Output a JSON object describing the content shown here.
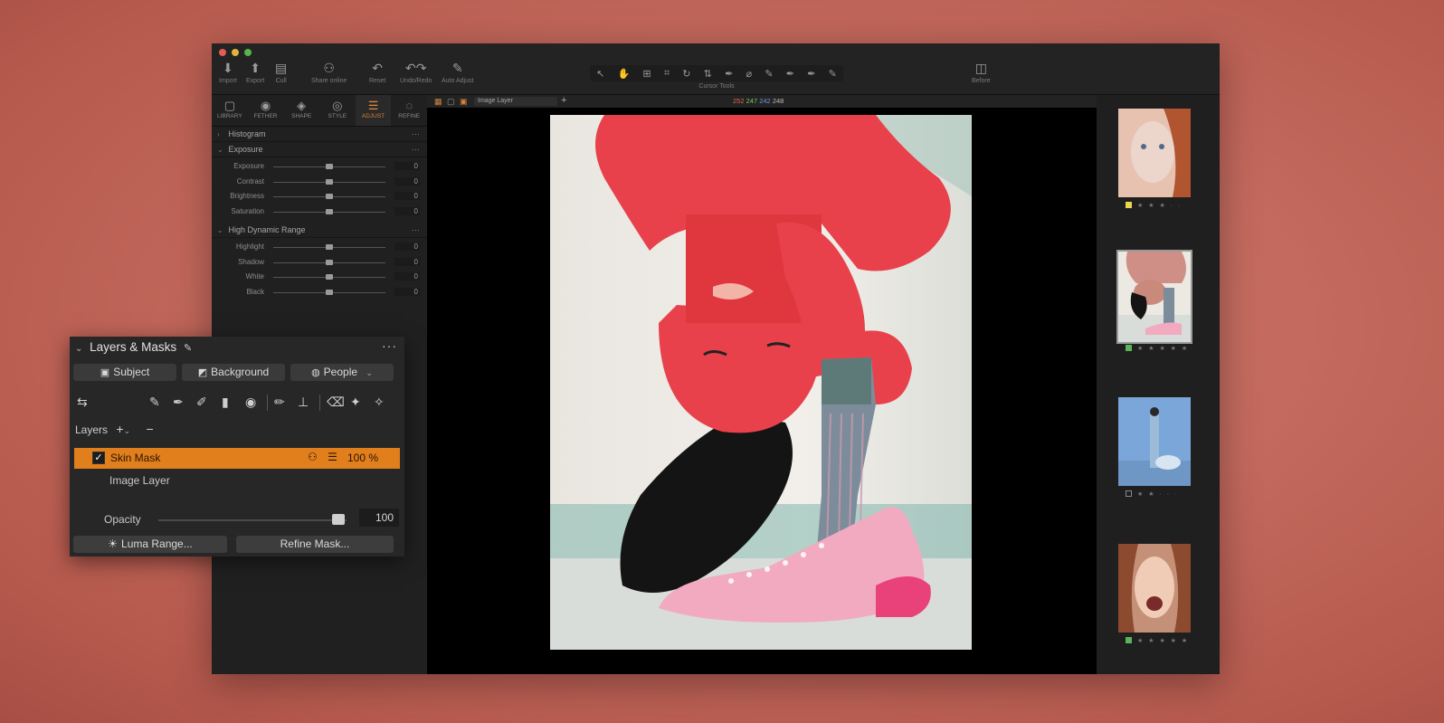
{
  "toolbar": {
    "items": [
      {
        "label": "Import",
        "icon": "import-icon",
        "glyph": "⬇"
      },
      {
        "label": "Export",
        "icon": "export-icon",
        "glyph": "⬆"
      },
      {
        "label": "Cull",
        "icon": "cull-icon",
        "glyph": "▤"
      },
      {
        "label": "Share online",
        "icon": "share-icon",
        "glyph": "⚇"
      },
      {
        "label": "Reset",
        "icon": "reset-icon",
        "glyph": "↶"
      },
      {
        "label": "Undo/Redo",
        "icon": "undo-redo-icon",
        "glyph": "↶↷"
      },
      {
        "label": "Auto Adjust",
        "icon": "auto-adjust-icon",
        "glyph": "✎"
      },
      {
        "label": "Before",
        "icon": "before-icon",
        "glyph": "◫"
      }
    ],
    "cursor_tools_label": "Cursor Tools",
    "cursor_tools_glyphs": [
      "↖",
      "✋",
      "⊞",
      "⌗",
      "↻",
      "⇅",
      "✒",
      "⌀",
      "✎",
      "✒",
      "✒",
      "✎"
    ]
  },
  "tool_tabs": [
    {
      "label": "LIBRARY",
      "glyph": "▢"
    },
    {
      "label": "FETHER",
      "glyph": "◉"
    },
    {
      "label": "SHAPE",
      "glyph": "◈"
    },
    {
      "label": "STYLE",
      "glyph": "◎"
    },
    {
      "label": "ADJUST",
      "glyph": "☰",
      "active": true
    },
    {
      "label": "REFINE",
      "glyph": "◌"
    }
  ],
  "sections": {
    "histogram": "Histogram",
    "exposure": {
      "title": "Exposure",
      "rows": [
        {
          "label": "Exposure",
          "value": "0"
        },
        {
          "label": "Contrast",
          "value": "0"
        },
        {
          "label": "Brightness",
          "value": "0"
        },
        {
          "label": "Saturation",
          "value": "0"
        }
      ]
    },
    "hdr": {
      "title": "High Dynamic Range",
      "rows": [
        {
          "label": "Highlight",
          "value": "0"
        },
        {
          "label": "Shadow",
          "value": "0"
        },
        {
          "label": "White",
          "value": "0"
        },
        {
          "label": "Black",
          "value": "0"
        }
      ]
    }
  },
  "viewer": {
    "layer_select": "Image Layer",
    "rgb": {
      "r": "252",
      "g": "247",
      "b": "242",
      "k": "248"
    }
  },
  "filmstrip": [
    {
      "rating_color": "#e8d64f",
      "stars": "★ ★ ★ · ·"
    },
    {
      "rating_color": "#5bb35b",
      "stars": "★ ★ ★ ★ ★",
      "selected": true
    },
    {
      "rating_color": "#1f1f1f",
      "stars": "★ ★ · · ·"
    },
    {
      "rating_color": "#5bb35b",
      "stars": "★ ★ ★ ★ ★"
    }
  ],
  "layers_panel": {
    "title": "Layers & Masks",
    "buttons": [
      "Subject",
      "Background",
      "People"
    ],
    "layers_label": "Layers",
    "selected_layer": {
      "name": "Skin Mask",
      "opacity": "100 %"
    },
    "other_layer": "Image Layer",
    "opacity_label": "Opacity",
    "opacity_value": "100",
    "luma_range": "Luma Range...",
    "refine_mask": "Refine Mask..."
  },
  "colors": {
    "accent": "#e07f1c",
    "mask_red": "#e8414b"
  }
}
